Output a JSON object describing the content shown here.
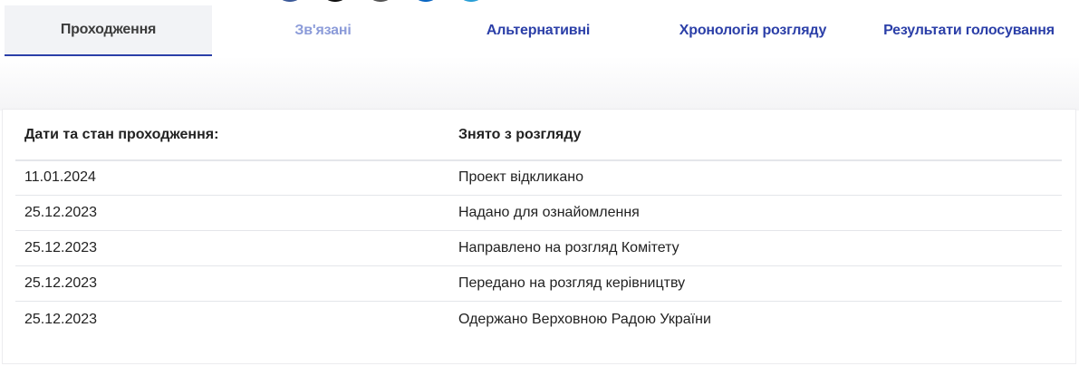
{
  "tabs": [
    {
      "label": "Проходження",
      "state": "active"
    },
    {
      "label": "Зв'язані",
      "state": "muted"
    },
    {
      "label": "Альтернативні",
      "state": "normal"
    },
    {
      "label": "Хронологія розгляду",
      "state": "normal"
    },
    {
      "label": "Результати голосування",
      "state": "normal"
    }
  ],
  "table": {
    "headers": [
      "Дати та стан проходження:",
      "Знято з розгляду"
    ],
    "rows": [
      {
        "date": "11.01.2024",
        "event": "Проект відкликано"
      },
      {
        "date": "25.12.2023",
        "event": "Надано для ознайомлення"
      },
      {
        "date": "25.12.2023",
        "event": "Направлено на розгляд Комітету"
      },
      {
        "date": "25.12.2023",
        "event": "Передано на розгляд керівництву"
      },
      {
        "date": "25.12.2023",
        "event": "Одержано Верховною Радою України"
      }
    ]
  },
  "share_icons": [
    {
      "name": "facebook-icon",
      "color": "#3b5998"
    },
    {
      "name": "x-icon",
      "color": "#111111"
    },
    {
      "name": "email-icon",
      "color": "#555555"
    },
    {
      "name": "linkedin-icon",
      "color": "#0a66c2"
    },
    {
      "name": "telegram-icon",
      "color": "#2a9fd6"
    }
  ],
  "colors": {
    "accent": "#2b3fa8",
    "muted_tab": "#8b9bd9",
    "active_tab_bg": "#f2f3f6"
  }
}
